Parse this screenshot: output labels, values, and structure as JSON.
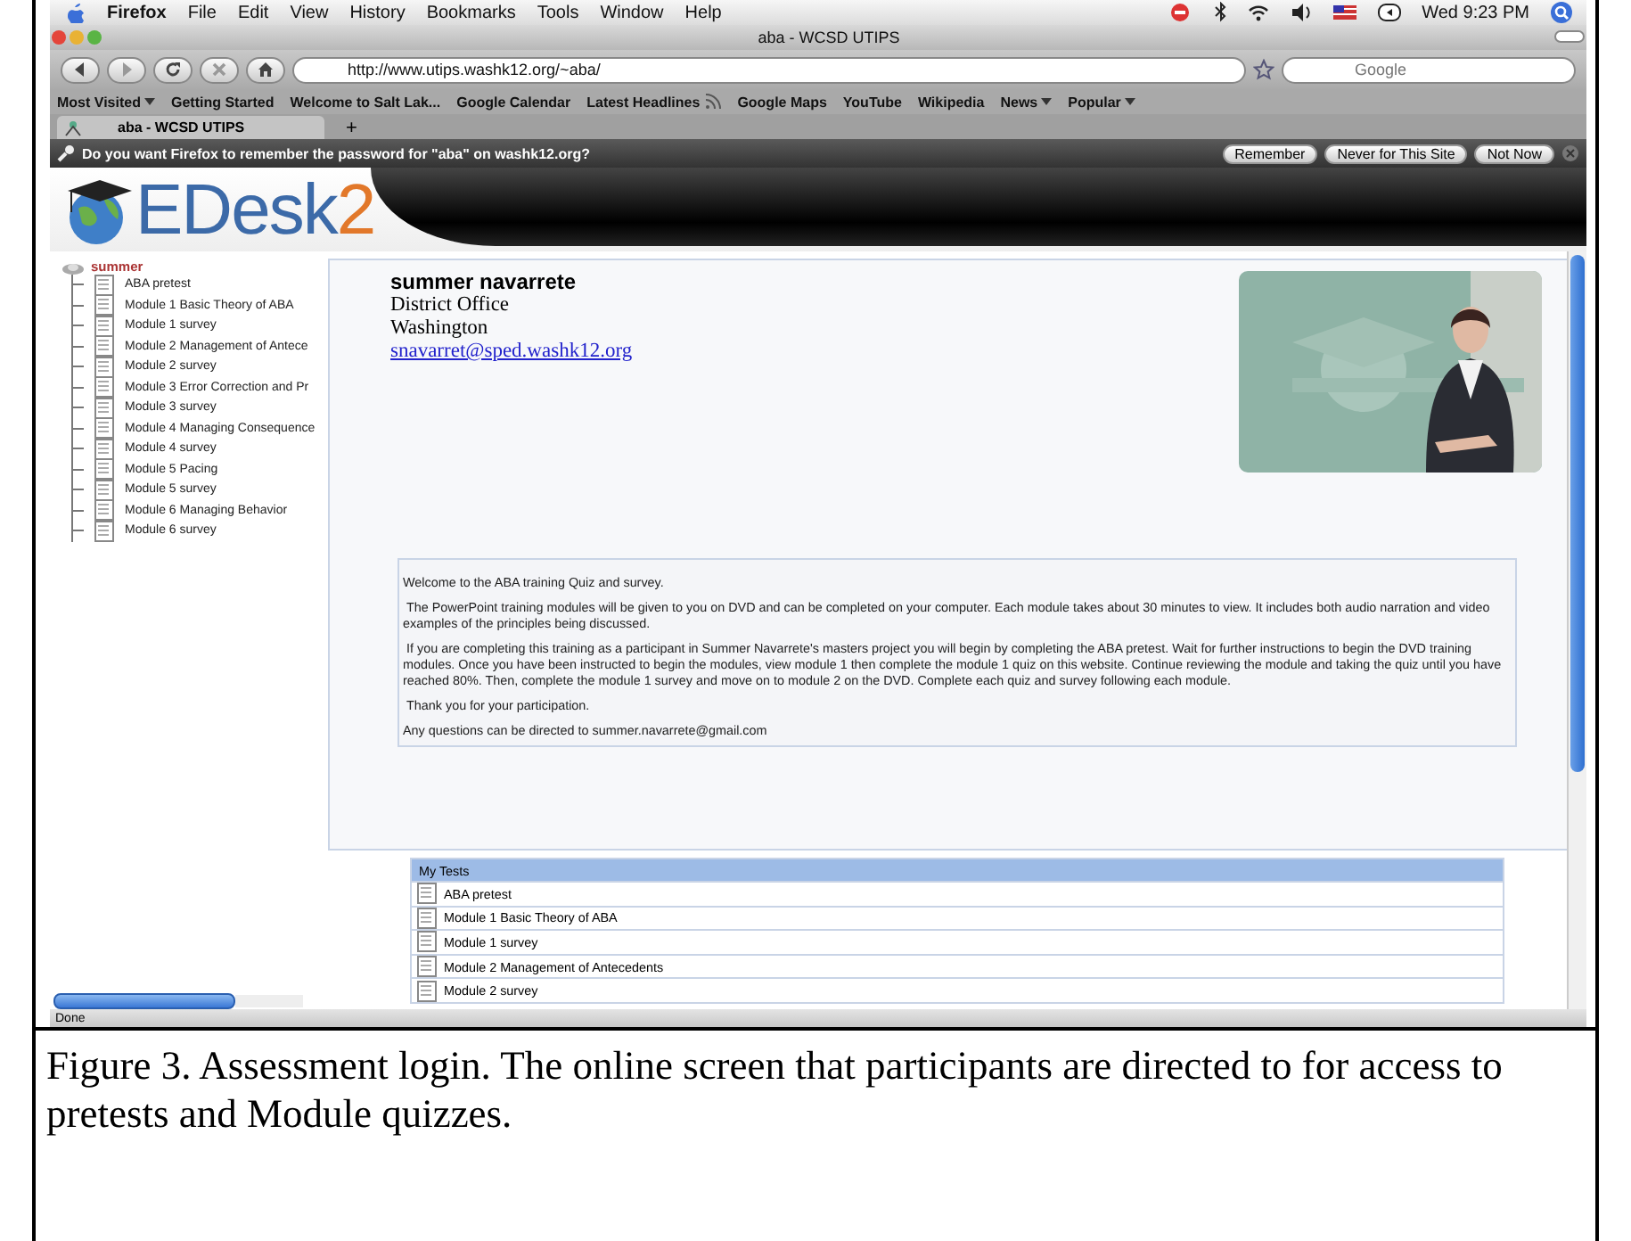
{
  "menubar": {
    "app": "Firefox",
    "items": [
      "File",
      "Edit",
      "View",
      "History",
      "Bookmarks",
      "Tools",
      "Window",
      "Help"
    ],
    "clock": "Wed 9:23 PM"
  },
  "window": {
    "title": "aba - WCSD UTIPS"
  },
  "toolbar": {
    "url": "http://www.utips.washk12.org/~aba/",
    "search_placeholder": "Google"
  },
  "bookmarks": [
    {
      "label": "Most Visited",
      "dropdown": true
    },
    {
      "label": "Getting Started",
      "dropdown": false
    },
    {
      "label": "Welcome to Salt Lak...",
      "dropdown": false
    },
    {
      "label": "Google Calendar",
      "dropdown": false
    },
    {
      "label": "Latest Headlines",
      "dropdown": false,
      "feed": true
    },
    {
      "label": "Google Maps",
      "dropdown": false
    },
    {
      "label": "YouTube",
      "dropdown": false
    },
    {
      "label": "Wikipedia",
      "dropdown": false
    },
    {
      "label": "News",
      "dropdown": true
    },
    {
      "label": "Popular",
      "dropdown": true
    }
  ],
  "tabs": [
    {
      "label": "aba - WCSD UTIPS",
      "selected": true
    }
  ],
  "new_tab": "+",
  "notification": {
    "text": "Do you want Firefox to remember the password for \"aba\" on washk12.org?",
    "buttons": [
      "Remember",
      "Never for This Site",
      "Not Now"
    ]
  },
  "logo": {
    "text": "EDesk",
    "suffix": "2"
  },
  "sidebar": {
    "user": "summer",
    "items": [
      "ABA pretest",
      "Module 1 Basic Theory of ABA",
      "Module 1 survey",
      "Module 2 Management of Antece",
      "Module 2 survey",
      "Module 3 Error Correction and Pr",
      "Module 3 survey",
      "Module 4 Managing Consequence",
      "Module 4 survey",
      "Module 5 Pacing",
      "Module 5 survey",
      "Module 6 Managing Behavior",
      "Module 6 survey"
    ]
  },
  "profile": {
    "name": "summer navarrete",
    "office": "District Office",
    "city": "Washington",
    "email": "snavarret@sped.washk12.org"
  },
  "welcome": [
    "Welcome to the ABA training Quiz and survey.",
    " The PowerPoint training modules will be given to you on DVD and can be completed on your computer. Each module takes about 30 minutes to view. It includes both audio narration and video examples of the principles being discussed.",
    " If you are completing this training as a participant in Summer Navarrete's masters project you will begin by completing the ABA pretest. Wait for further instructions to begin the DVD training modules. Once you have been instructed to begin the modules, view module 1 then complete the module 1 quiz on this website. Continue reviewing the module and taking the quiz until you have reached 80%. Then, complete the module 1 survey and move on to module 2 on the DVD. Complete each quiz and survey following each module.",
    " Thank you for your participation.",
    "Any questions can be directed to summer.navarrete@gmail.com"
  ],
  "my_tests": {
    "title": "My Tests",
    "rows": [
      "ABA pretest",
      "Module 1 Basic Theory of ABA",
      "Module 1 survey",
      "Module 2 Management of Antecedents",
      "Module 2 survey"
    ]
  },
  "status_bar": "Done",
  "caption": "Figure 3. Assessment login. The online screen that participants are directed to for access to pretests and Module quizzes."
}
